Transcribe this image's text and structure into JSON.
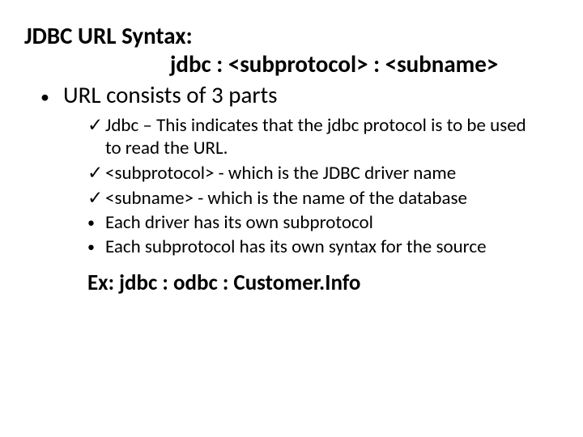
{
  "title": "JDBC URL Syntax:",
  "syntax": "jdbc : <subprotocol> : <subname>",
  "main_bullet": "URL consists of 3 parts",
  "sub": {
    "a": "Jdbc – This indicates that the jdbc protocol is to be used to read the URL.",
    "b": "<subprotocol> - which is the JDBC driver name",
    "c": "<subname> - which is the name of the database",
    "d": "Each driver has its own subprotocol",
    "e": "Each subprotocol has its own syntax for the source"
  },
  "example": "Ex:  jdbc : odbc : Customer.Info",
  "marks": {
    "check": "✓",
    "bullet": "•"
  }
}
